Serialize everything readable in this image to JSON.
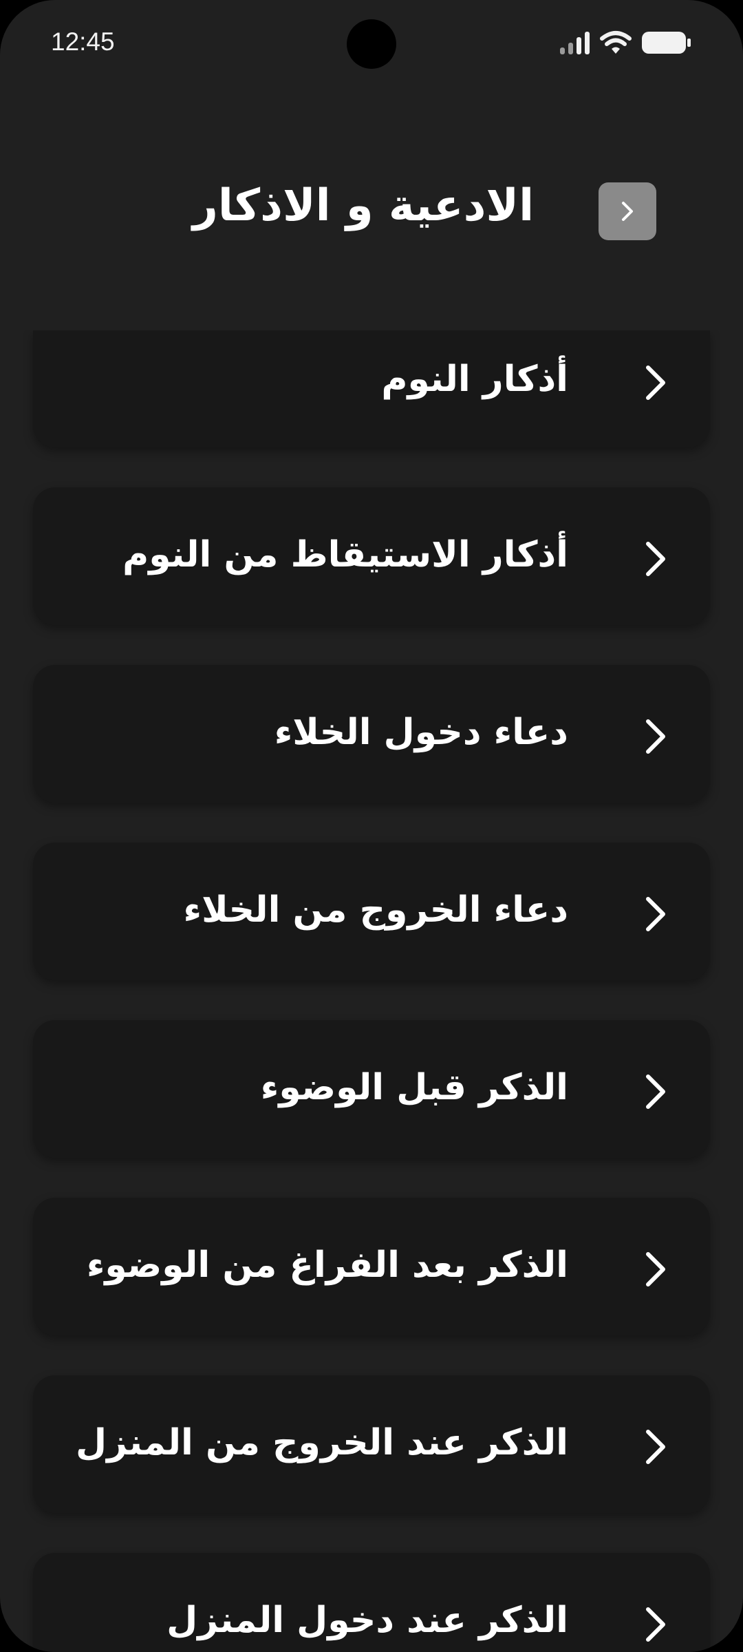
{
  "status_bar": {
    "time": "12:45"
  },
  "header": {
    "title": "الادعية و الاذكار",
    "back_icon": "chevron-right-icon"
  },
  "list": {
    "items": [
      {
        "label": "أذكار النوم"
      },
      {
        "label": "أذكار الاستيقاظ من النوم"
      },
      {
        "label": "دعاء دخول الخلاء"
      },
      {
        "label": "دعاء الخروج من الخلاء"
      },
      {
        "label": "الذكر قبل الوضوء"
      },
      {
        "label": "الذكر بعد الفراغ من الوضوء"
      },
      {
        "label": "الذكر عند الخروج من المنزل"
      },
      {
        "label": "الذكر عند دخول المنزل"
      }
    ]
  },
  "colors": {
    "background": "#202020",
    "card": "#181818",
    "back_button": "#8a8a8a",
    "text": "#ffffff"
  }
}
